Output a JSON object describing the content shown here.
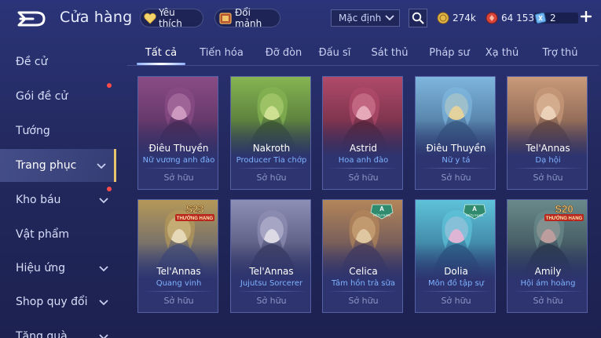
{
  "header": {
    "title": "Cửa hàng",
    "favorite_label": "Yêu thích",
    "swap_label": "Đổi mảnh",
    "sort_value": "Mặc định",
    "gold": "274k",
    "gems": "64 153",
    "tickets": "2"
  },
  "sidebar": {
    "items": [
      {
        "label": "Đề cử",
        "chevron": false,
        "dot": false,
        "active": false
      },
      {
        "label": "Gói đề cử",
        "chevron": false,
        "dot": true,
        "active": false
      },
      {
        "label": "Tướng",
        "chevron": false,
        "dot": false,
        "active": false
      },
      {
        "label": "Trang phục",
        "chevron": true,
        "dot": false,
        "active": true
      },
      {
        "label": "Kho báu",
        "chevron": true,
        "dot": true,
        "active": false
      },
      {
        "label": "Vật phẩm",
        "chevron": false,
        "dot": false,
        "active": false
      },
      {
        "label": "Hiệu ứng",
        "chevron": true,
        "dot": false,
        "active": false
      },
      {
        "label": "Shop quy đổi",
        "chevron": true,
        "dot": false,
        "active": false
      },
      {
        "label": "Tặng quà",
        "chevron": true,
        "dot": false,
        "active": false
      }
    ]
  },
  "tabs": [
    "Tất cả",
    "Tiến hóa",
    "Đỡ đòn",
    "Đấu sĩ",
    "Sát thủ",
    "Pháp sư",
    "Xạ thủ",
    "Trợ thủ"
  ],
  "active_tab": "Tất cả",
  "cards": [
    {
      "hero": "Điêu Thuyền",
      "skin": "Nữ vương anh đào",
      "status": "Sở hữu",
      "badge": "",
      "colors": [
        "#4a2a55",
        "#8a4c86",
        "#d7a3c8"
      ]
    },
    {
      "hero": "Nakroth",
      "skin": "Producer Tia chớp",
      "status": "Sở hữu",
      "badge": "",
      "colors": [
        "#3d5a2e",
        "#86b552",
        "#d9e99a"
      ]
    },
    {
      "hero": "Astrid",
      "skin": "Hoa anh đào",
      "status": "Sở hữu",
      "badge": "",
      "colors": [
        "#5a2438",
        "#b04a6b",
        "#f0b6c4"
      ]
    },
    {
      "hero": "Điêu Thuyền",
      "skin": "Nữ y tá",
      "status": "Sở hữu",
      "badge": "",
      "colors": [
        "#3a5f86",
        "#7fb6de",
        "#f2d99a"
      ]
    },
    {
      "hero": "Tel'Annas",
      "skin": "Dạ hội",
      "status": "Sở hữu",
      "badge": "",
      "colors": [
        "#6a4a3e",
        "#c99a7a",
        "#f3dcc2"
      ]
    },
    {
      "hero": "Tel'Annas",
      "skin": "Quang vinh",
      "status": "Sở hữu",
      "badge": "S23 THƯỞNG HẠNG",
      "colors": [
        "#4a5478",
        "#b59858",
        "#efe3c0"
      ]
    },
    {
      "hero": "Tel'Annas",
      "skin": "Jujutsu Sorcerer",
      "status": "Sở hữu",
      "badge": "",
      "colors": [
        "#3d3f63",
        "#8e8fb5",
        "#e9e6ee"
      ]
    },
    {
      "hero": "Celica",
      "skin": "Tâm hồn trà sữa",
      "status": "Sở hữu",
      "badge": "A HỮU HẠN",
      "colors": [
        "#4a3e5a",
        "#b3865a",
        "#e9d2a8"
      ]
    },
    {
      "hero": "Dolia",
      "skin": "Môn đồ tập sự",
      "status": "Sở hữu",
      "badge": "A HỮU HẠN",
      "colors": [
        "#2c5f86",
        "#5ec3d9",
        "#f0b8d8"
      ]
    },
    {
      "hero": "Amily",
      "skin": "Hội ám hoàng",
      "status": "Sở hữu",
      "badge": "S20 THƯỞNG HẠNG",
      "colors": [
        "#2b3a4a",
        "#6a8a8a",
        "#c9a3a3"
      ]
    }
  ],
  "colors": {
    "accent_gold": "#e8c46a",
    "skin_name": "#7fb2ff",
    "owned": "#8c96c4",
    "notification_dot": "#ff4a4a"
  }
}
